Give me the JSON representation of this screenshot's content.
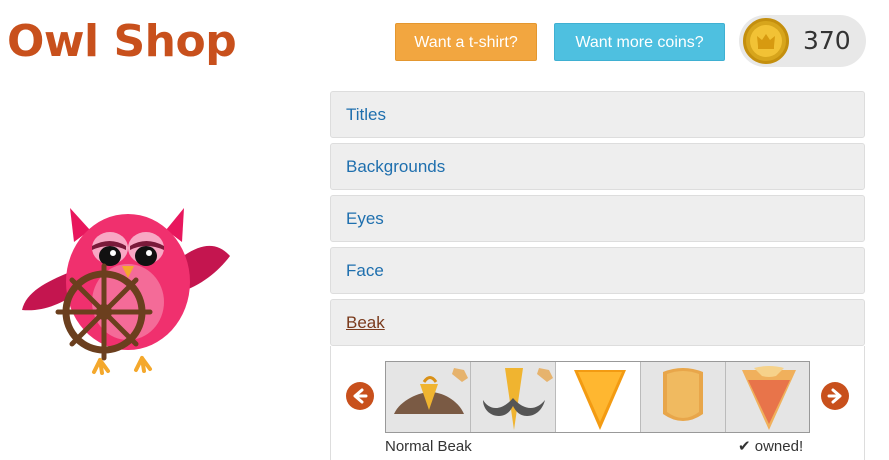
{
  "header": {
    "title": "Owl Shop",
    "tshirt_button": "Want a t-shirt?",
    "coins_button": "Want more coins?",
    "coin_count": "370"
  },
  "accordion": [
    {
      "label": "Titles"
    },
    {
      "label": "Backgrounds"
    },
    {
      "label": "Eyes"
    },
    {
      "label": "Face"
    },
    {
      "label": "Beak"
    }
  ],
  "beak_panel": {
    "selected_name": "Normal Beak",
    "status": "owned!",
    "items": [
      {
        "name": "normal-beak",
        "tagged": true
      },
      {
        "name": "mustache-beak",
        "tagged": true
      },
      {
        "name": "orange-cone-beak",
        "tagged": false
      },
      {
        "name": "rounded-beak",
        "tagged": false
      },
      {
        "name": "layered-beak",
        "tagged": false
      }
    ]
  },
  "colors": {
    "brand": "#c8501c",
    "tshirt_button": "#f2a640",
    "coins_button": "#4ec0e0",
    "link": "#1e6fae"
  }
}
